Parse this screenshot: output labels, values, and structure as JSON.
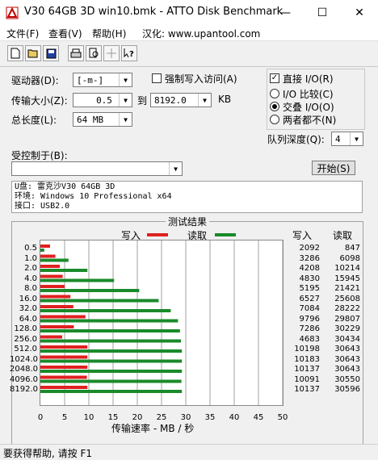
{
  "window": {
    "title": "V30 64GB 3D win10.bmk - ATTO Disk Benchmark",
    "minimize": "—",
    "maximize": "☐",
    "close": "✕"
  },
  "menu": {
    "file": "文件(F)",
    "view": "查看(V)",
    "help": "帮助(H)",
    "localized_by": "汉化: www.upantool.com"
  },
  "toolbar": [
    "new-icon",
    "open-icon",
    "save-icon",
    "print-icon",
    "print-preview-icon",
    "move-icon",
    "help-pointer-icon"
  ],
  "controls": {
    "drive_label": "驱动器(D):",
    "drive_value": "[-m-]",
    "force_write_label": "强制写入访问(A)",
    "force_write_checked": false,
    "direct_io_label": "直接 I/O(R)",
    "direct_io_checked": true,
    "transfer_size_label": "传输大小(Z):",
    "transfer_from": "0.5",
    "to_label": "到",
    "transfer_to": "8192.0",
    "kb_label": "KB",
    "io_compare_label": "I/O 比较(C)",
    "io_overlap_label": "交叠 I/O(O)",
    "neither_label": "两者都不(N)",
    "selected_io_mode": "交叠 I/O(O)",
    "total_length_label": "总长度(L):",
    "total_length_value": "64 MB",
    "queue_depth_label": "队列深度(Q):",
    "queue_depth_value": "4",
    "controlled_by_label": "受控制于(B):",
    "controlled_by_value": "",
    "start_button": "开始(S)"
  },
  "info": {
    "line1": "U盘: 雷克沙V30 64GB 3D",
    "line2": "环境: Windows 10 Professional x64",
    "line3": "接口: USB2.0"
  },
  "results": {
    "title": "测试结果",
    "write_header": "写入",
    "read_header": "读取"
  },
  "status": "要获得帮助, 请按 F1",
  "colors": {
    "write": "#e02020",
    "read": "#1a8a2a"
  },
  "chart_data": {
    "type": "bar",
    "orientation": "horizontal",
    "categories": [
      "0.5",
      "1.0",
      "2.0",
      "4.0",
      "8.0",
      "16.0",
      "32.0",
      "64.0",
      "128.0",
      "256.0",
      "512.0",
      "1024.0",
      "2048.0",
      "4096.0",
      "8192.0"
    ],
    "series": [
      {
        "name": "写入",
        "values": [
          2.0,
          3.1,
          4.0,
          4.6,
          5.0,
          6.2,
          6.8,
          9.3,
          6.9,
          4.5,
          9.7,
          9.7,
          9.7,
          9.6,
          9.7
        ]
      },
      {
        "name": "读取",
        "values": [
          0.8,
          5.8,
          9.7,
          15.2,
          20.4,
          24.4,
          26.9,
          28.4,
          28.8,
          29.0,
          29.2,
          29.2,
          29.2,
          29.1,
          29.2
        ]
      }
    ],
    "write_text": [
      "2092",
      "3286",
      "4208",
      "4830",
      "5195",
      "6527",
      "7084",
      "9796",
      "7286",
      "4683",
      "10198",
      "10183",
      "10137",
      "10091",
      "10137"
    ],
    "read_text": [
      "847",
      "6098",
      "10214",
      "15945",
      "21421",
      "25608",
      "28222",
      "29807",
      "30229",
      "30434",
      "30643",
      "30643",
      "30643",
      "30550",
      "30596"
    ],
    "xlabel": "传输速率 - MB / 秒",
    "xticks": [
      "0",
      "5",
      "10",
      "15",
      "20",
      "25",
      "30",
      "35",
      "40",
      "45",
      "50"
    ],
    "xlim": [
      0,
      50
    ],
    "grid": "vertical"
  }
}
